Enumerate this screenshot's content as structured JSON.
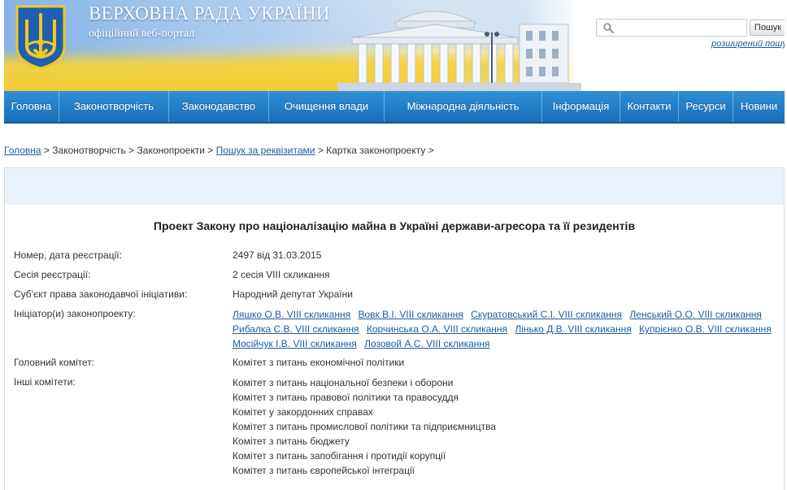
{
  "header": {
    "title": "ВЕРХОВНА РАДА УКРАЇНИ",
    "subtitle": "офіційний веб-портал",
    "search_placeholder": "",
    "search_button": "Пошук",
    "advanced_search": "розширений пошук"
  },
  "nav": {
    "items": [
      {
        "label": "Головна"
      },
      {
        "label": "Законотворчість"
      },
      {
        "label": "Законодавство"
      },
      {
        "label": "Очищення влади"
      },
      {
        "label": "Міжнародна діяльність"
      },
      {
        "label": "Інформація"
      },
      {
        "label": "Контакти"
      },
      {
        "label": "Ресурси"
      },
      {
        "label": "Новини"
      }
    ]
  },
  "breadcrumb": {
    "items": [
      "Головна",
      "Законотворчість",
      "Законопроекти",
      "Пошук за реквізитами",
      "Картка законопроекту"
    ],
    "separator": ">"
  },
  "bill": {
    "title": "Проект Закону про націоналізацію майна в Україні держави-агресора та її резидентів",
    "fields": [
      {
        "label": "Номер, дата реєстрації:",
        "value": "2497 від 31.03.2015"
      },
      {
        "label": "Сесія реєстрації:",
        "value": "2 сесія VIII скликання"
      },
      {
        "label": "Суб'єкт права законодавчої ініціативи:",
        "value": "Народний депутат України"
      }
    ],
    "initiators_label": "Ініціатор(и) законопроекту:",
    "initiators": [
      "Ляшко О.В. VIII скликання",
      "Вовк В.І. VIII скликання",
      "Скуратовський С.І. VIII скликання",
      "Ленський О.О. VIII скликання",
      "Рибалка С.В. VIII скликання",
      "Корчинська О.А. VIII скликання",
      "Лінько Д.В. VIII скликання",
      "Купрієнко О.В. VIII скликання",
      "Мосійчук І.В. VIII скликання",
      "Лозовой А.С. VIII скликання"
    ],
    "main_committee_label": "Головний комітет:",
    "main_committee": "Комітет з питань економічної політики",
    "other_committees_label": "Інші комітети:",
    "other_committees": [
      "Комітет з питань національної безпеки і оборони",
      "Комітет з питань правової політики та правосуддя",
      "Комітет у закордонних справах",
      "Комітет з питань промислової політики та підприємництва",
      "Комітет з питань бюджету",
      "Комітет з питань запобігання і протидії корупції",
      "Комітет з питань європейської інтеграції"
    ]
  },
  "colors": {
    "nav_bg": "#1a6fb8",
    "link": "#1a5d9e",
    "band_bg": "#e9f2fb",
    "flag_yellow": "#f1d24a",
    "flag_blue": "#78aae6"
  }
}
